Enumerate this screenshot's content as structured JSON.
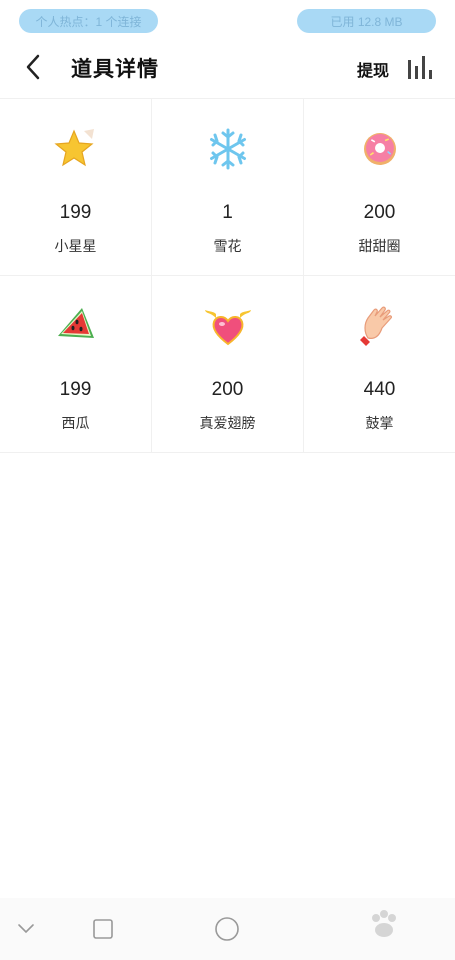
{
  "status_bar": {
    "hotspot": "个人热点：1 个连接",
    "data_used": "已用 12.8 MB"
  },
  "header": {
    "title": "道具详情",
    "withdraw_label": "提现",
    "back_icon": "chevron-left-icon",
    "chart_icon": "bar-chart-icon"
  },
  "items": [
    {
      "count": "199",
      "name": "小星星",
      "icon": "star-icon"
    },
    {
      "count": "1",
      "name": "雪花",
      "icon": "snowflake-icon"
    },
    {
      "count": "200",
      "name": "甜甜圈",
      "icon": "donut-icon"
    },
    {
      "count": "199",
      "name": "西瓜",
      "icon": "watermelon-icon"
    },
    {
      "count": "200",
      "name": "真爱翅膀",
      "icon": "winged-heart-icon"
    },
    {
      "count": "440",
      "name": "鼓掌",
      "icon": "clapping-hands-icon"
    }
  ],
  "nav_bar": {
    "icons": [
      "back-chevron-icon",
      "recent-apps-square-icon",
      "home-circle-icon"
    ]
  },
  "colors": {
    "status_pill": "#a9d9f5",
    "divider": "#f0f0f0"
  }
}
